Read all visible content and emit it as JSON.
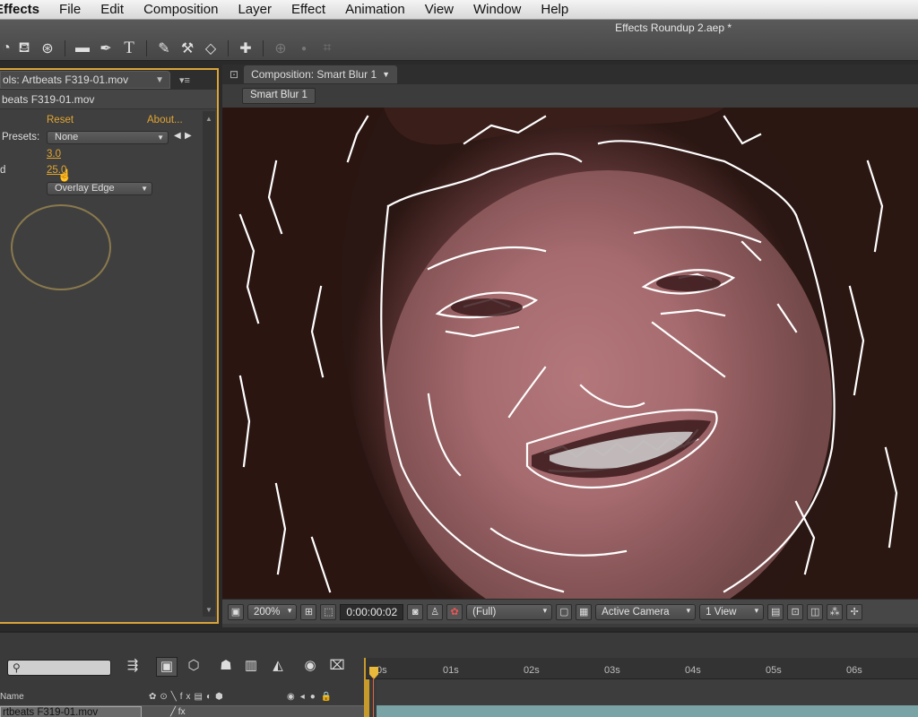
{
  "menubar": {
    "app": "Effects",
    "items": [
      "File",
      "Edit",
      "Composition",
      "Layer",
      "Effect",
      "Animation",
      "View",
      "Window",
      "Help"
    ]
  },
  "toolbar": {
    "document_title": "Effects Roundup 2.aep *",
    "tools": [
      "camera-orbit-icon",
      "pan-behind-icon",
      "rectangle-icon",
      "pen-icon",
      "type-icon",
      "brush-icon",
      "eraser-icon",
      "puppet-icon"
    ]
  },
  "effect_controls": {
    "tab_label": "ols: Artbeats F319-01.mov",
    "layer_label": "beats F319-01.mov",
    "reset_label": "Reset",
    "about_label": "About...",
    "presets_label": "Presets:",
    "presets_value": "None",
    "radius_value": "3.0",
    "threshold_label": "d",
    "threshold_value": "25.0",
    "mode_value": "Overlay Edge"
  },
  "composition": {
    "tab_label": "Composition: Smart Blur 1",
    "breadcrumb": "Smart Blur 1",
    "zoom": "200%",
    "timecode": "0:00:00:02",
    "resolution": "(Full)",
    "camera": "Active Camera",
    "views": "1 View"
  },
  "timeline": {
    "search_placeholder": "",
    "ruler_ticks": [
      "0s",
      "01s",
      "02s",
      "03s",
      "04s",
      "05s",
      "06s"
    ],
    "column_name": "Name",
    "layer_name": "rtbeats F319-01.mov",
    "accent_color": "#e9b93a",
    "layer_bar_color": "#7aa3a6"
  }
}
